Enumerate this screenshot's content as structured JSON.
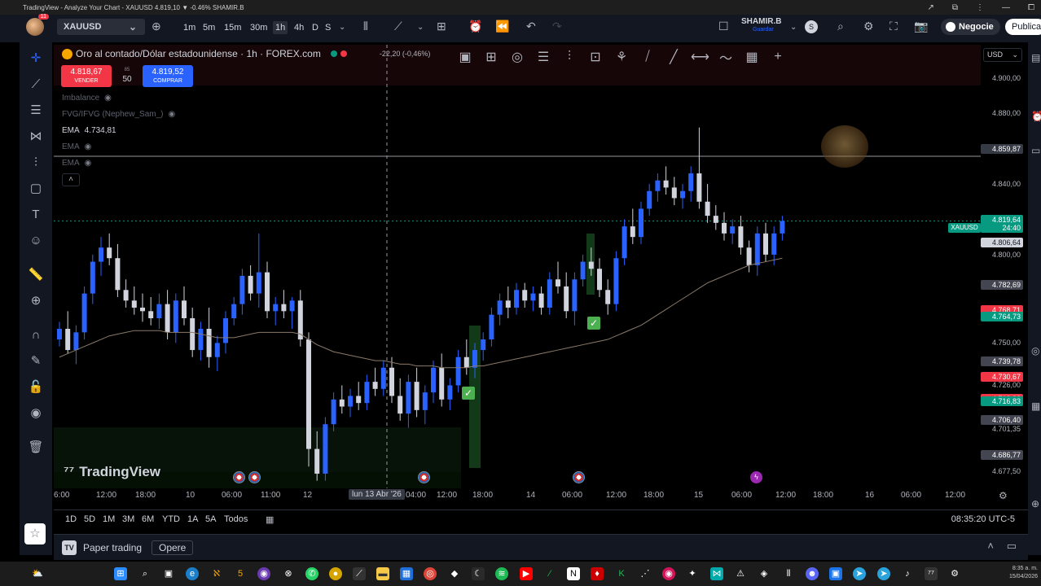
{
  "window": {
    "title": "TradingView - Analyze Your Chart - XAUUSD 4.819,10 ▼ -0.46% SHAMIR.B",
    "controls": [
      "↗",
      "⧉",
      "⋮",
      "—",
      "⧠"
    ]
  },
  "toolbar": {
    "notification_count": "11",
    "symbol": "XAUUSD",
    "intervals": [
      "1m",
      "5m",
      "15m",
      "30m",
      "1h",
      "4h",
      "D",
      "S"
    ],
    "active_interval": "1h",
    "user_name": "SHAMIR.B",
    "user_sub": "Guardar",
    "avatar_letter": "S",
    "negocie_label": "Negocie",
    "publicar_label": "Publica"
  },
  "legend": {
    "title": "Oro al contado/Dólar estadounidense · 1h · FOREX.com",
    "change": "-22,20 (-0,46%)",
    "sell_price": "4.818,67",
    "sell_label": "VENDER",
    "spread": "50",
    "spread_small": "85",
    "buy_price": "4.819,52",
    "buy_label": "COMPRAR",
    "indicators": [
      {
        "name": "Imbalance",
        "value": ""
      },
      {
        "name": "FVG/IFVG (Nephew_Sam_)",
        "value": ""
      },
      {
        "name": "EMA",
        "value": "4.734,81"
      },
      {
        "name": "EMA",
        "value": ""
      },
      {
        "name": "EMA",
        "value": ""
      }
    ],
    "collapse_icon": "˄"
  },
  "drawing_tools": [
    "▣",
    "⊞",
    "◎",
    "☰",
    "⫶",
    "⊡",
    "⚘",
    "⧸",
    "╱",
    "⟷",
    "〜",
    "▦",
    "+"
  ],
  "price_axis": {
    "currency": "USD",
    "labels": [
      {
        "text": "4.900,00",
        "type": "plain"
      },
      {
        "text": "4.880,00",
        "type": "plain"
      },
      {
        "text": "4.859,87",
        "type": "crosshair"
      },
      {
        "text": "4.840,00",
        "type": "plain"
      },
      {
        "text": "4.819,64",
        "type": "green"
      },
      {
        "text": "24:40",
        "type": "green"
      },
      {
        "text": "4.806,64",
        "type": "white"
      },
      {
        "text": "4.800,00",
        "type": "plain"
      },
      {
        "text": "4.782,69",
        "type": "gray"
      },
      {
        "text": "4.768,71",
        "type": "red"
      },
      {
        "text": "4.764,73",
        "type": "green"
      },
      {
        "text": "4.750,00",
        "type": "plain"
      },
      {
        "text": "4.739,78",
        "type": "gray"
      },
      {
        "text": "4.730,67",
        "type": "red"
      },
      {
        "text": "4.726,00",
        "type": "plain"
      },
      {
        "text": "4.718,32",
        "type": "red"
      },
      {
        "text": "4.716,83",
        "type": "green"
      },
      {
        "text": "4.706,40",
        "type": "gray"
      },
      {
        "text": "4.701,35",
        "type": "plain"
      },
      {
        "text": "4.686,77",
        "type": "gray"
      },
      {
        "text": "4.677,50",
        "type": "plain"
      }
    ],
    "symbol_tag": "XAUUSD"
  },
  "time_axis": {
    "labels": [
      "6:00",
      "12:00",
      "18:00",
      "10",
      "06:00",
      "11:00",
      "12",
      "lun 13 Abr '26",
      "04:00",
      "12:00",
      "18:00",
      "14",
      "06:00",
      "12:00",
      "18:00",
      "15",
      "06:00",
      "12:00",
      "18:00",
      "16",
      "06:00",
      "12:00"
    ],
    "crosshair_label": "lun 13 Abr '26"
  },
  "watermark": "TradingView",
  "ranges": {
    "items": [
      "1D",
      "5D",
      "1M",
      "3M",
      "6M",
      "YTD",
      "1A",
      "5A",
      "Todos"
    ],
    "clock": "08:35:20 UTC-5"
  },
  "bottom_panel": {
    "paper_trading": "Paper trading",
    "opere": "Opere"
  },
  "taskbar": {
    "clock": "8:35 a. m.",
    "date": "15/04/2026"
  },
  "colors": {
    "up": "#2962ff",
    "down": "#d1d4dc",
    "ema": "#8a7a6a",
    "accent": "#2962ff",
    "sell": "#f23645",
    "buy": "#2962ff",
    "green": "#089981"
  },
  "chart_data": {
    "type": "candlestick",
    "series_note": "",
    "y_axis_range": [
      4670,
      4905
    ],
    "candles": [
      [
        4752,
        4762,
        4748,
        4758
      ],
      [
        4758,
        4768,
        4744,
        4746
      ],
      [
        4746,
        4760,
        4738,
        4756
      ],
      [
        4756,
        4782,
        4752,
        4778
      ],
      [
        4778,
        4800,
        4772,
        4796
      ],
      [
        4796,
        4810,
        4788,
        4804
      ],
      [
        4804,
        4812,
        4794,
        4798
      ],
      [
        4798,
        4806,
        4776,
        4780
      ],
      [
        4780,
        4786,
        4770,
        4774
      ],
      [
        4774,
        4782,
        4766,
        4770
      ],
      [
        4770,
        4778,
        4762,
        4768
      ],
      [
        4768,
        4776,
        4760,
        4764
      ],
      [
        4764,
        4778,
        4758,
        4772
      ],
      [
        4772,
        4780,
        4752,
        4756
      ],
      [
        4756,
        4778,
        4750,
        4774
      ],
      [
        4774,
        4782,
        4760,
        4764
      ],
      [
        4764,
        4770,
        4742,
        4746
      ],
      [
        4746,
        4762,
        4740,
        4758
      ],
      [
        4758,
        4770,
        4736,
        4742
      ],
      [
        4742,
        4754,
        4734,
        4750
      ],
      [
        4750,
        4768,
        4744,
        4764
      ],
      [
        4764,
        4776,
        4760,
        4772
      ],
      [
        4772,
        4792,
        4766,
        4788
      ],
      [
        4788,
        4794,
        4774,
        4778
      ],
      [
        4778,
        4812,
        4770,
        4790
      ],
      [
        4790,
        4796,
        4764,
        4768
      ],
      [
        4768,
        4776,
        4760,
        4772
      ],
      [
        4772,
        4780,
        4764,
        4768
      ],
      [
        4768,
        4776,
        4758,
        4774
      ],
      [
        4774,
        4780,
        4748,
        4752
      ],
      [
        4752,
        4756,
        4680,
        4690
      ],
      [
        4690,
        4700,
        4672,
        4676
      ],
      [
        4676,
        4708,
        4672,
        4704
      ],
      [
        4704,
        4722,
        4700,
        4718
      ],
      [
        4718,
        4726,
        4710,
        4714
      ],
      [
        4714,
        4724,
        4708,
        4720
      ],
      [
        4720,
        4728,
        4712,
        4716
      ],
      [
        4716,
        4732,
        4712,
        4728
      ],
      [
        4728,
        4736,
        4720,
        4724
      ],
      [
        4724,
        4740,
        4720,
        4736
      ],
      [
        4736,
        4742,
        4716,
        4720
      ],
      [
        4720,
        4730,
        4706,
        4710
      ],
      [
        4710,
        4732,
        4702,
        4728
      ],
      [
        4728,
        4736,
        4708,
        4712
      ],
      [
        4712,
        4726,
        4704,
        4722
      ],
      [
        4722,
        4740,
        4716,
        4736
      ],
      [
        4736,
        4744,
        4714,
        4718
      ],
      [
        4718,
        4730,
        4712,
        4726
      ],
      [
        4726,
        4746,
        4722,
        4742
      ],
      [
        4742,
        4752,
        4732,
        4736
      ],
      [
        4736,
        4750,
        4730,
        4746
      ],
      [
        4746,
        4756,
        4740,
        4752
      ],
      [
        4752,
        4770,
        4748,
        4766
      ],
      [
        4766,
        4778,
        4760,
        4774
      ],
      [
        4774,
        4782,
        4764,
        4770
      ],
      [
        4770,
        4784,
        4766,
        4780
      ],
      [
        4780,
        4784,
        4770,
        4774
      ],
      [
        4774,
        4782,
        4768,
        4778
      ],
      [
        4778,
        4782,
        4766,
        4770
      ],
      [
        4770,
        4790,
        4766,
        4786
      ],
      [
        4786,
        4796,
        4778,
        4782
      ],
      [
        4782,
        4790,
        4764,
        4768
      ],
      [
        4768,
        4790,
        4760,
        4786
      ],
      [
        4786,
        4800,
        4782,
        4796
      ],
      [
        4796,
        4804,
        4788,
        4792
      ],
      [
        4792,
        4798,
        4776,
        4780
      ],
      [
        4780,
        4786,
        4766,
        4772
      ],
      [
        4772,
        4802,
        4768,
        4798
      ],
      [
        4798,
        4820,
        4794,
        4816
      ],
      [
        4816,
        4826,
        4806,
        4810
      ],
      [
        4810,
        4830,
        4806,
        4826
      ],
      [
        4826,
        4840,
        4822,
        4836
      ],
      [
        4836,
        4846,
        4830,
        4842
      ],
      [
        4842,
        4850,
        4834,
        4838
      ],
      [
        4838,
        4844,
        4828,
        4832
      ],
      [
        4832,
        4840,
        4826,
        4836
      ],
      [
        4836,
        4850,
        4830,
        4846
      ],
      [
        4846,
        4872,
        4826,
        4830
      ],
      [
        4830,
        4840,
        4818,
        4822
      ],
      [
        4822,
        4828,
        4814,
        4818
      ],
      [
        4818,
        4824,
        4808,
        4812
      ],
      [
        4812,
        4820,
        4806,
        4816
      ],
      [
        4816,
        4822,
        4800,
        4804
      ],
      [
        4804,
        4808,
        4790,
        4794
      ],
      [
        4794,
        4816,
        4788,
        4812
      ],
      [
        4812,
        4818,
        4796,
        4800
      ],
      [
        4800,
        4816,
        4794,
        4812
      ],
      [
        4812,
        4822,
        4808,
        4819
      ]
    ],
    "ema": [
      4742,
      4744,
      4746,
      4748,
      4750,
      4752,
      4754,
      4755,
      4756,
      4757,
      4757,
      4757,
      4757,
      4756,
      4756,
      4756,
      4756,
      4755,
      4754,
      4753,
      4753,
      4753,
      4754,
      4755,
      4756,
      4756,
      4756,
      4756,
      4756,
      4755,
      4752,
      4749,
      4747,
      4745,
      4744,
      4743,
      4742,
      4741,
      4740,
      4740,
      4739,
      4738,
      4738,
      4737,
      4737,
      4737,
      4736,
      4736,
      4736,
      4736,
      4737,
      4737,
      4738,
      4739,
      4740,
      4741,
      4742,
      4743,
      4744,
      4745,
      4746,
      4747,
      4748,
      4749,
      4750,
      4751,
      4752,
      4754,
      4756,
      4758,
      4760,
      4763,
      4766,
      4769,
      4772,
      4775,
      4778,
      4781,
      4784,
      4786,
      4788,
      4790,
      4792,
      4794,
      4795,
      4796,
      4797,
      4798
    ]
  }
}
